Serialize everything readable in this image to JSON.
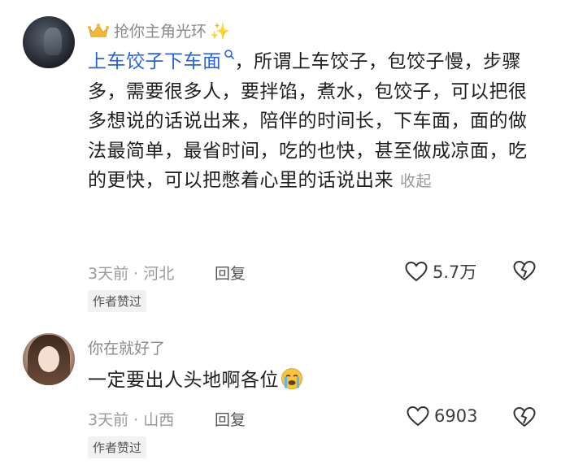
{
  "comments": [
    {
      "username": "抢你主角光环",
      "link_text": "上车饺子下车面",
      "body": "，所谓上车饺子，包饺子慢，步骤多，需要很多人，要拌馅，煮水，包饺子，可以把很多想说的话说出来，陪伴的时间长，下车面，面的做法最简单，最省时间，吃的也快，甚至做成凉面，吃的更快，可以把憋着心里的话说出来",
      "collapse_label": "收起",
      "time_location": "3天前 · 河北",
      "reply_label": "回复",
      "like_count": "5.7万",
      "badge": "作者赞过"
    },
    {
      "username": "你在就好了",
      "body": "一定要出人头地啊各位",
      "time_location": "3天前 · 山西",
      "reply_label": "回复",
      "like_count": "6903",
      "badge": "作者赞过"
    }
  ],
  "icons": {
    "crown": "crown-icon",
    "sparkle": "sparkle-icon",
    "search_hint": "search-icon",
    "like": "heart-icon",
    "dislike": "broken-heart-icon",
    "emoji": "crying-face-emoji"
  },
  "colors": {
    "link": "#2c63d6",
    "muted": "#9a9a9a"
  }
}
